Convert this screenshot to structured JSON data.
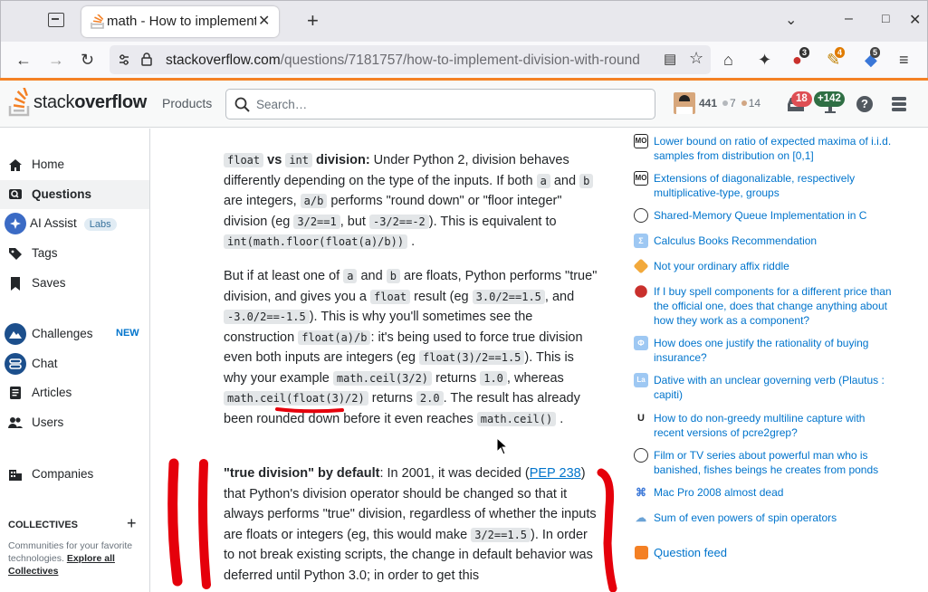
{
  "browser": {
    "tab_title": "math - How to implement division with round",
    "url_host": "stackoverflow.com",
    "url_path": "/questions/7181757/how-to-implement-division-with-round",
    "ext_badges": [
      "3",
      "4",
      "5"
    ]
  },
  "header": {
    "logo_plain": "stack",
    "logo_bold": "overflow",
    "products": "Products",
    "search_placeholder": "Search…",
    "reputation": "441",
    "silver": "7",
    "bronze": "14",
    "inbox_count": "18",
    "rep_change": "+142"
  },
  "sidebar": {
    "home": "Home",
    "questions": "Questions",
    "ai_assist": "AI Assist",
    "labs": "Labs",
    "tags": "Tags",
    "saves": "Saves",
    "challenges": "Challenges",
    "new": "NEW",
    "chat": "Chat",
    "articles": "Articles",
    "users": "Users",
    "companies": "Companies",
    "collectives_heading": "COLLECTIVES",
    "collectives_text": "Communities for your favorite technologies.",
    "explore_link": "Explore all Collectives"
  },
  "answer": {
    "p1": {
      "c1": "float",
      "b1": " vs ",
      "c2": "int",
      "b2": " division:",
      "t1": " Under Python 2, division behaves differently depending on the type of the inputs. If both ",
      "c3": "a",
      "t2": " and ",
      "c4": "b",
      "t3": " are integers, ",
      "c5": "a/b",
      "t4": " performs \"round down\" or \"floor integer\" division (eg ",
      "c6": "3/2==1",
      "t5": ", but ",
      "c7": "-3/2==-2",
      "t6": "). This is equivalent to ",
      "c8": "int(math.floor(float(a)/b))",
      "t7": " ."
    },
    "p2": {
      "t1": "But if at least one of ",
      "c1": "a",
      "t2": " and ",
      "c2": "b",
      "t3": " are floats, Python performs \"true\" division, and gives you a ",
      "c3": "float",
      "t4": " result (eg ",
      "c4": "3.0/2==1.5",
      "t5": ", and ",
      "c5": "-3.0/2==-1.5",
      "t6": "). This is why you'll sometimes see the construction ",
      "c6": "float(a)/b",
      "t7": ": it's being used to force true division even both inputs are integers (eg ",
      "c7": "float(3)/2==1.5",
      "t8": "). This is why your example ",
      "c8": "math.ceil(3/2)",
      "t9": " returns ",
      "c9": "1.0",
      "t10": ", whereas ",
      "c10": "math.ceil(float(3)/2)",
      "t11": " returns ",
      "c11": "2.0",
      "t12": ". The result has already been rounded down before it even reaches ",
      "c12": "math.ceil()",
      "t13": " ."
    },
    "p3": {
      "b1": "\"true division\" by default",
      "t1": ": In 2001, it was decided (",
      "link": "PEP 238",
      "t2": ") that Python's division operator should be changed so that it always performs \"true\" division, regardless of whether the inputs are floats or integers (eg, this would make ",
      "c1": "3/2==1.5",
      "t3": "). In order to not break existing scripts, the change in default behavior was deferred until Python 3.0; in order to get this"
    }
  },
  "hot_questions": [
    {
      "title": "Lower bound on ratio of expected maxima of i.i.d. samples from distribution on [0,1]",
      "icon": "mo-icon",
      "color": "#ffffff"
    },
    {
      "title": "Extensions of diagonalizable, respectively multiplicative-type, groups",
      "icon": "mo-icon",
      "color": "#ffffff"
    },
    {
      "title": "Shared-Memory Queue Implementation in C",
      "icon": "codereview-icon",
      "color": "#ffffff"
    },
    {
      "title": "Calculus Books Recommendation",
      "icon": "math-icon",
      "color": "#9ec8f3"
    },
    {
      "title": "Not your ordinary affix riddle",
      "icon": "puzzling-icon",
      "color": "#f2a93b"
    },
    {
      "title": "If I buy spell components for a different price than the official one, does that change anything about how they work as a component?",
      "icon": "rpg-icon",
      "color": "#c9302c"
    },
    {
      "title": "How does one justify the rationality of buying insurance?",
      "icon": "philosophy-icon",
      "color": "#9ec8f3"
    },
    {
      "title": "Dative with an unclear governing verb (Plautus : capiti)",
      "icon": "latin-icon",
      "color": "#9ec8f3"
    },
    {
      "title": "How to do non-greedy multiline capture with recent versions of pcre2grep?",
      "icon": "unix-icon",
      "color": "#ffffff"
    },
    {
      "title": "Film or TV series about powerful man who is banished, fishes beings he creates from ponds",
      "icon": "scifi-icon",
      "color": "#ffffff"
    },
    {
      "title": "Mac Pro 2008 almost dead",
      "icon": "apple-icon",
      "color": "#ffffff"
    },
    {
      "title": "Sum of even powers of spin operators",
      "icon": "physics-icon",
      "color": "#ffffff"
    }
  ],
  "question_feed": "Question feed",
  "colors": {
    "accent": "#f48225",
    "link": "#0074cc",
    "annotation": "#e5000b"
  }
}
